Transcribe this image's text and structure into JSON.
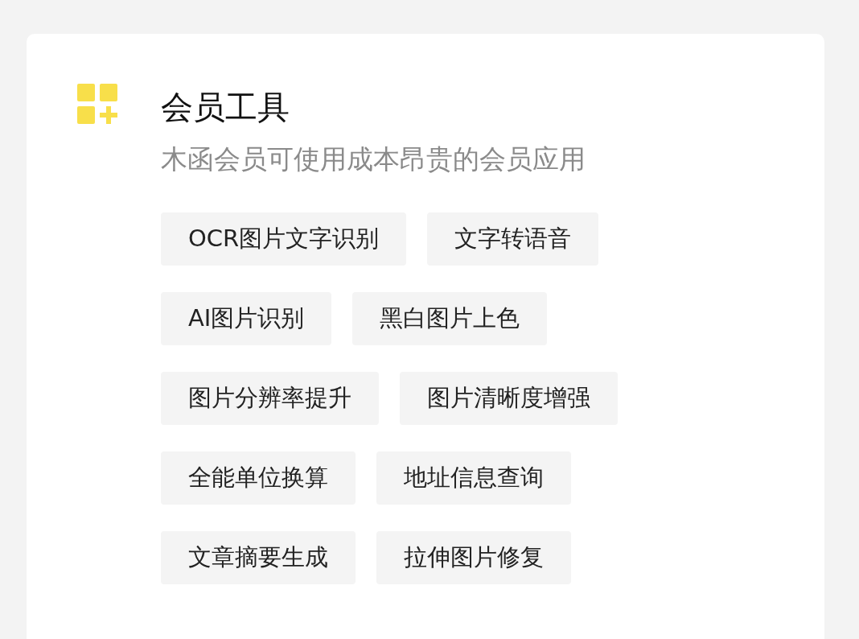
{
  "section": {
    "title": "会员工具",
    "subtitle": "木函会员可使用成本昂贵的会员应用"
  },
  "tool_rows": [
    {
      "tools": [
        {
          "label": "OCR图片文字识别"
        },
        {
          "label": "文字转语音"
        }
      ]
    },
    {
      "tools": [
        {
          "label": "AI图片识别"
        },
        {
          "label": "黑白图片上色"
        }
      ]
    },
    {
      "tools": [
        {
          "label": "图片分辨率提升"
        },
        {
          "label": "图片清晰度增强"
        }
      ]
    },
    {
      "tools": [
        {
          "label": "全能单位换算"
        },
        {
          "label": "地址信息查询"
        }
      ]
    },
    {
      "tools": [
        {
          "label": "文章摘要生成"
        },
        {
          "label": "拉伸图片修复"
        }
      ]
    }
  ]
}
